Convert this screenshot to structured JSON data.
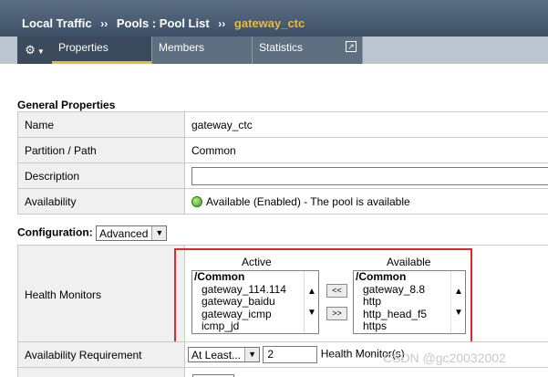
{
  "breadcrumb": {
    "section": "Local Traffic",
    "sep1": "››",
    "path": "Pools : Pool List",
    "sep2": "››",
    "current": "gateway_ctc"
  },
  "tabs": {
    "gear_icon": "gear-icon",
    "properties": "Properties",
    "members": "Members",
    "statistics": "Statistics",
    "external_icon": "external-link-icon"
  },
  "general": {
    "title": "General Properties",
    "rows": {
      "name_label": "Name",
      "name_value": "gateway_ctc",
      "partition_label": "Partition / Path",
      "partition_value": "Common",
      "description_label": "Description",
      "description_value": "",
      "availability_label": "Availability",
      "availability_value": "Available (Enabled) - The pool is available"
    }
  },
  "configuration": {
    "label": "Configuration:",
    "mode": "Advanced"
  },
  "health_monitors": {
    "label": "Health Monitors",
    "active_title": "Active",
    "available_title": "Available",
    "active_group": "/Common",
    "active_items": [
      "gateway_114.114",
      "gateway_baidu",
      "gateway_icmp",
      "icmp_jd"
    ],
    "available_group": "/Common",
    "available_items": [
      "gateway_8.8",
      "http",
      "http_head_f5",
      "https"
    ],
    "move_left": "<<",
    "move_right": ">>"
  },
  "availability_requirement": {
    "label": "Availability Requirement",
    "mode": "At Least...",
    "count": "2",
    "suffix": "Health Monitor(s)"
  },
  "watermark": "CSDN @gc20032002",
  "colors": {
    "header_bg": "#3e5066",
    "accent": "#f2b632",
    "highlight_border": "#e0282b",
    "status_green": "#3f9a1c"
  }
}
